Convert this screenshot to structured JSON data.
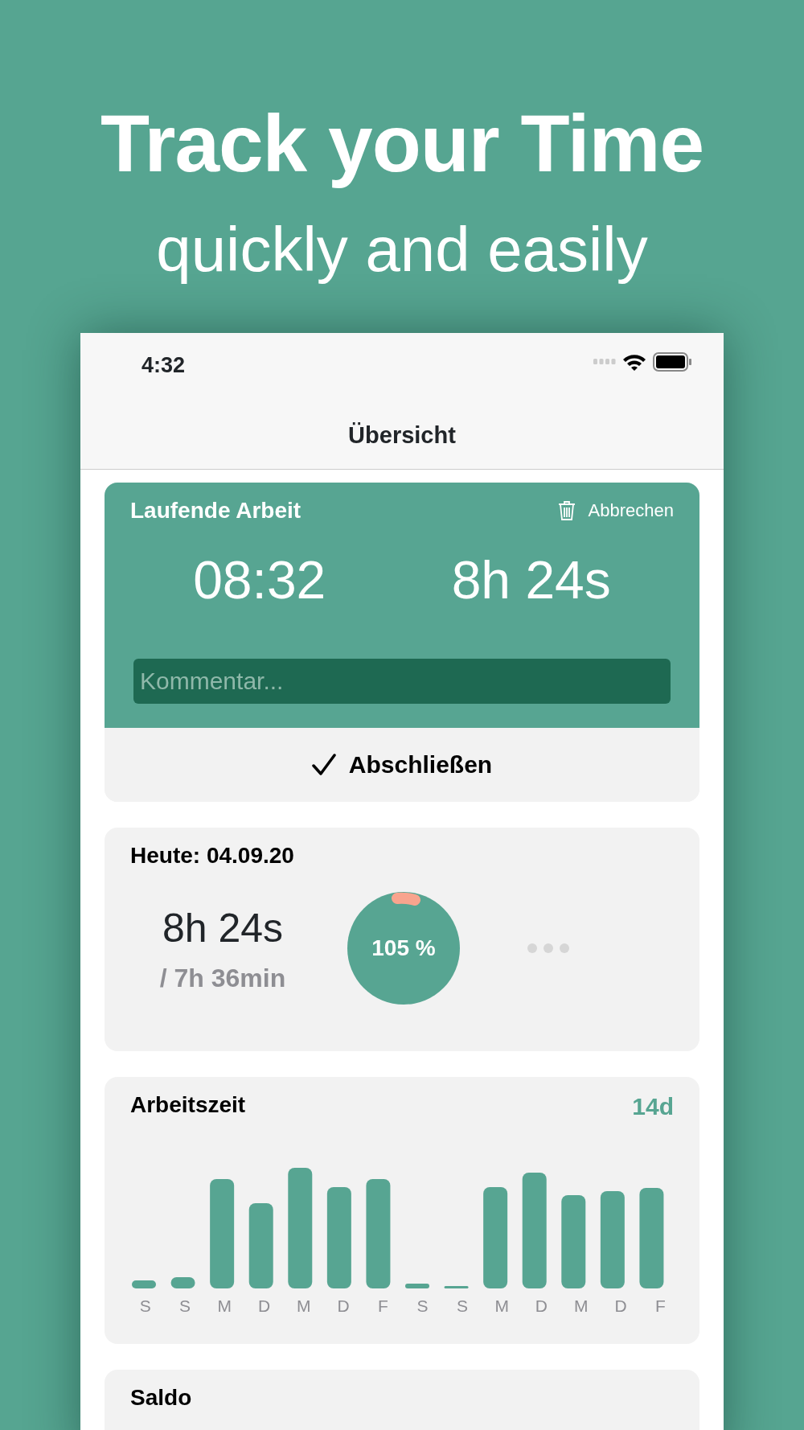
{
  "headline": "Track your Time",
  "subheadline": "quickly and easily",
  "status_bar": {
    "time": "4:32"
  },
  "nav": {
    "title": "Übersicht"
  },
  "running": {
    "title": "Laufende Arbeit",
    "cancel": "Abbrechen",
    "start": "08:32",
    "duration": "8h 24s",
    "comment": {
      "placeholder": "Kommentar..."
    },
    "finish": "Abschließen"
  },
  "today": {
    "title": "Heute: 04.09.20",
    "worked": "8h 24s",
    "target": "/ 7h 36min",
    "percent": "105 %"
  },
  "worktime": {
    "title": "Arbeitszeit",
    "range": "14d",
    "days": [
      "S",
      "S",
      "M",
      "D",
      "M",
      "D",
      "F",
      "S",
      "S",
      "M",
      "D",
      "M",
      "D",
      "F"
    ]
  },
  "saldo": {
    "title": "Saldo"
  }
}
